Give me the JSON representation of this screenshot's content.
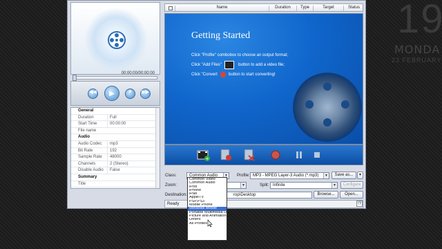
{
  "desktop": {
    "clock_big": "19",
    "clock_day": "MONDA",
    "clock_date": "23 FEBRUARY"
  },
  "preview": {
    "time": "00:00:00/00:00:00",
    "progress": 0
  },
  "properties": {
    "rows": [
      {
        "key": "General",
        "value": "",
        "group": true
      },
      {
        "key": "Duration",
        "value": "Full"
      },
      {
        "key": "Start Time",
        "value": "00:00:00"
      },
      {
        "key": "File name",
        "value": ""
      },
      {
        "key": "Audio",
        "value": "",
        "group": true
      },
      {
        "key": "Audio Codec",
        "value": "mp3"
      },
      {
        "key": "Bit Rate",
        "value": "192"
      },
      {
        "key": "Sample Rate",
        "value": "48000"
      },
      {
        "key": "Channels",
        "value": "2 (Stereo)"
      },
      {
        "key": "Disable Audio",
        "value": "False"
      },
      {
        "key": "Summary",
        "value": "",
        "group": true
      },
      {
        "key": "Title",
        "value": ""
      }
    ]
  },
  "list": {
    "columns": [
      "Name",
      "Duration",
      "Type",
      "Target",
      "Status"
    ]
  },
  "getting_started": {
    "title": "Getting Started",
    "line1": "Click \"Profile\" combobox to choose an output format;",
    "line2a": "Click \"Add Files\"",
    "line2b": "button to add a video file;",
    "line3a": "Click \"Convert",
    "line3b": "button to start converting!"
  },
  "toolbar": {
    "icons": [
      "add-file-icon",
      "remove-file-icon",
      "clear-list-icon",
      "convert-icon",
      "pause-icon",
      "stop-icon"
    ]
  },
  "settings": {
    "class_label": "Class:",
    "class_value": "Common Audio",
    "profile_label": "Profile:",
    "profile_value": "MP3 - MPEG Layer-3 Audio  (*.mp3)",
    "save_as": "Save as...",
    "zoom_label": "Zoom:",
    "split_label": "Split:",
    "split_value": "Infinite",
    "configure": "Configure",
    "destination_label": "Destination:",
    "destination_value": "rop\\Desktop",
    "browse": "Browse...",
    "open": "Open..."
  },
  "status": {
    "text": "Ready",
    "help": "!?"
  },
  "class_dropdown": {
    "options": [
      "Common Video",
      "Common Audio",
      "iPod",
      "iPhone",
      "iPad",
      "AppleTV",
      "PSP,PS3",
      "Mobile Phone",
      "Windows Mobile",
      "Portable Multimedia Dev",
      "Picture and Animation",
      "Others",
      "All Profiles"
    ],
    "selected_index": 8
  },
  "colors": {
    "accent": "#1066cc",
    "selection": "#3a6fd0",
    "chrome": "#d6dbe5"
  }
}
